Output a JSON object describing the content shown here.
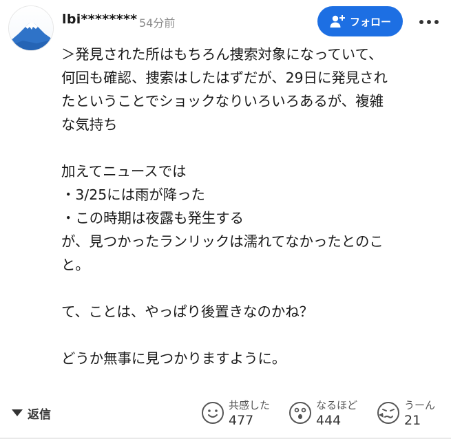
{
  "comment": {
    "author": "lbi********",
    "time": "54分前",
    "follow_label": "フォロー",
    "lines": [
      "＞発見された所はもちろん捜索対象になっていて、",
      "何回も確認、捜索はしたはずだが、29日に発見され",
      "たということでショックなりいろいろあるが、複雑",
      "な気持ち",
      "",
      "加えてニュースでは",
      "・3/25には雨が降った",
      "・この時期は夜露も発生する",
      "が、見つかったランリックは濡れてなかったとのこ",
      "と。",
      "",
      "て、ことは、やっぱり後置きなのかね？",
      "",
      "どうか無事に見つかりますように。"
    ]
  },
  "footer": {
    "reply_label": "返信",
    "reactions": [
      {
        "label": "共感した",
        "count": "477",
        "icon": "smile-face-icon"
      },
      {
        "label": "なるほど",
        "count": "444",
        "icon": "surprised-face-icon"
      },
      {
        "label": "うーん",
        "count": "21",
        "icon": "thinking-face-icon"
      }
    ]
  },
  "colors": {
    "accent": "#1d6fe3",
    "text": "#1a1a1a",
    "muted": "#8a8a8a"
  }
}
